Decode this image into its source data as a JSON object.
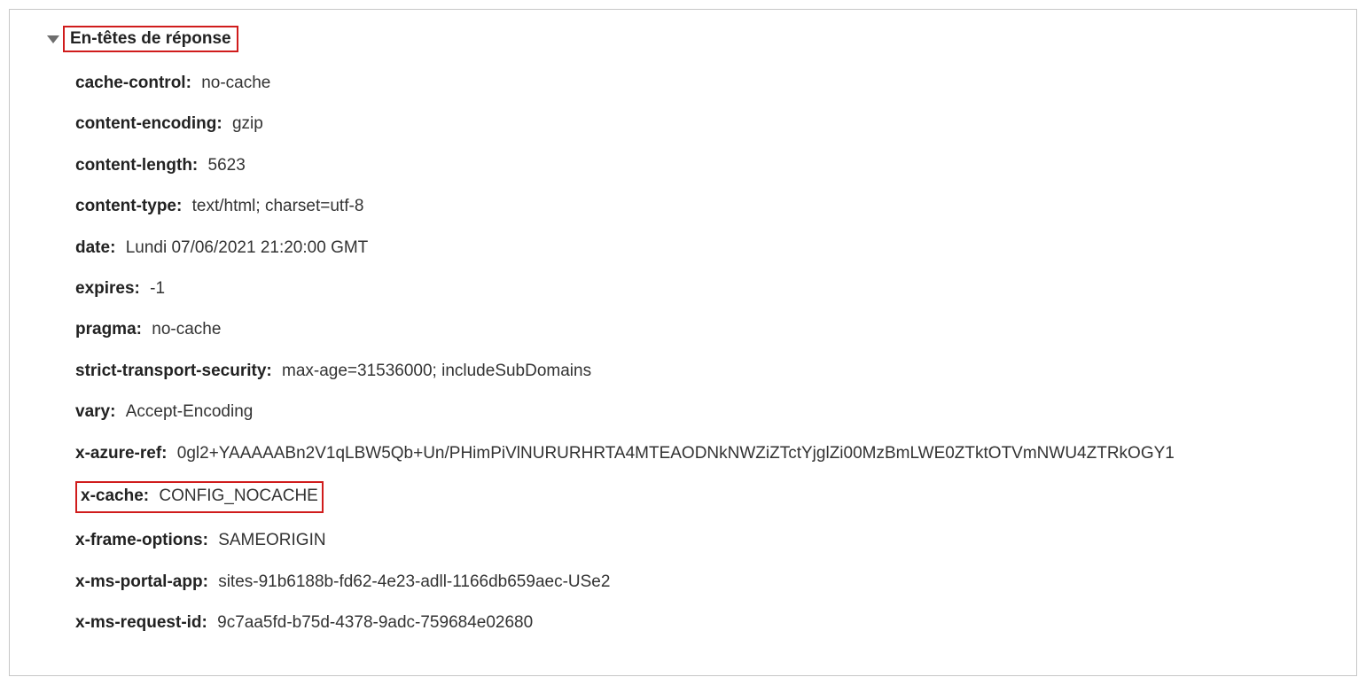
{
  "section": {
    "title": "En-têtes de réponse"
  },
  "headers": [
    {
      "key": "cache-control:",
      "value": "no-cache",
      "highlight": false
    },
    {
      "key": "content-encoding:",
      "value": "gzip",
      "highlight": false
    },
    {
      "key": "content-length:",
      "value": "5623",
      "highlight": false
    },
    {
      "key": "content-type:",
      "value": "text/html; charset=utf-8",
      "highlight": false
    },
    {
      "key": "date:",
      "value": "Lundi 07/06/2021 21:20:00 GMT",
      "highlight": false
    },
    {
      "key": "expires:",
      "value": "-1",
      "highlight": false
    },
    {
      "key": "pragma:",
      "value": "no-cache",
      "highlight": false
    },
    {
      "key": "strict-transport-security:",
      "value": "max-age=31536000; includeSubDomains",
      "highlight": false
    },
    {
      "key": "vary:",
      "value": "Accept-Encoding",
      "highlight": false
    },
    {
      "key": "x-azure-ref:",
      "value": "0gl2+YAAAAABn2V1qLBW5Qb+Un/PHimPiVlNURURHRTA4MTEAODNkNWZiZTctYjglZi00MzBmLWE0ZTktOTVmNWU4ZTRkOGY1",
      "highlight": false
    },
    {
      "key": "x-cache:",
      "value": "CONFIG_NOCACHE",
      "highlight": true
    },
    {
      "key": "x-frame-options:",
      "value": "SAMEORIGIN",
      "highlight": false
    },
    {
      "key": "x-ms-portal-app:",
      "value": "sites-91b6188b-fd62-4e23-adll-1166db659aec-USe2",
      "highlight": false
    },
    {
      "key": "x-ms-request-id:",
      "value": "9c7aa5fd-b75d-4378-9adc-759684e02680",
      "highlight": false
    }
  ]
}
